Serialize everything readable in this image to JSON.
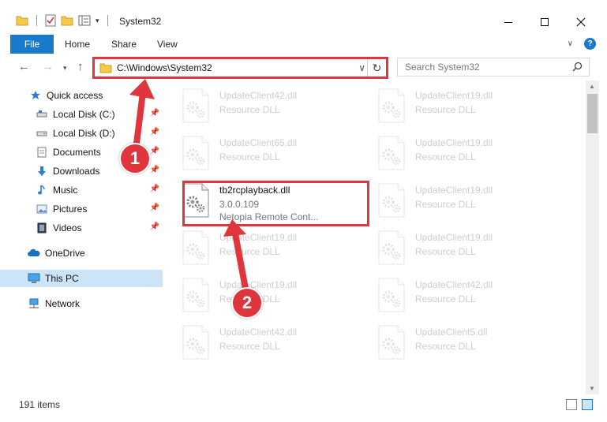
{
  "window": {
    "title": "System32"
  },
  "ribbon": {
    "tabs": [
      "File",
      "Home",
      "Share",
      "View"
    ]
  },
  "address": {
    "path": "C:\\Windows\\System32"
  },
  "search": {
    "placeholder": "Search System32"
  },
  "nav": {
    "quick_access": "Quick access",
    "items": [
      {
        "label": "Local Disk (C:)",
        "icon": "drive-icon"
      },
      {
        "label": "Local Disk (D:)",
        "icon": "drive-icon"
      },
      {
        "label": "Documents",
        "icon": "documents-icon"
      },
      {
        "label": "Downloads",
        "icon": "downloads-icon"
      },
      {
        "label": "Music",
        "icon": "music-icon"
      },
      {
        "label": "Pictures",
        "icon": "pictures-icon"
      },
      {
        "label": "Videos",
        "icon": "videos-icon"
      }
    ],
    "onedrive": "OneDrive",
    "thispc": "This PC",
    "network": "Network"
  },
  "files": {
    "left": [
      {
        "name": "UpdateClient42.dll",
        "sub": "Resource DLL"
      },
      {
        "name": "UpdateClient65.dll",
        "sub": "Resource DLL"
      },
      {
        "name": "tb2rcplayback.dll",
        "sub": "3.0.0.109",
        "sub2": "Netopia Remote Cont..."
      },
      {
        "name": "UpdateClient19.dll",
        "sub": "Resource DLL"
      },
      {
        "name": "UpdateClient19.dll",
        "sub": "Resource DLL"
      },
      {
        "name": "UpdateClient42.dll",
        "sub": "Resource DLL"
      }
    ],
    "right": [
      {
        "name": "UpdateClient19.dll",
        "sub": "Resource DLL"
      },
      {
        "name": "UpdateClient19.dll",
        "sub": "Resource DLL"
      },
      {
        "name": "UpdateClient19.dll",
        "sub": "Resource DLL"
      },
      {
        "name": "UpdateClient19.dll",
        "sub": "Resource DLL"
      },
      {
        "name": "UpdateClient42.dll",
        "sub": "Resource DLL"
      },
      {
        "name": "UpdateClient5.dll",
        "sub": "Resource DLL"
      }
    ]
  },
  "status": {
    "count": "191 items"
  },
  "annotations": {
    "step1": "1",
    "step2": "2"
  },
  "colors": {
    "accent": "#1979ca",
    "highlight": "#e0353c",
    "selected": "#cce4f7"
  }
}
